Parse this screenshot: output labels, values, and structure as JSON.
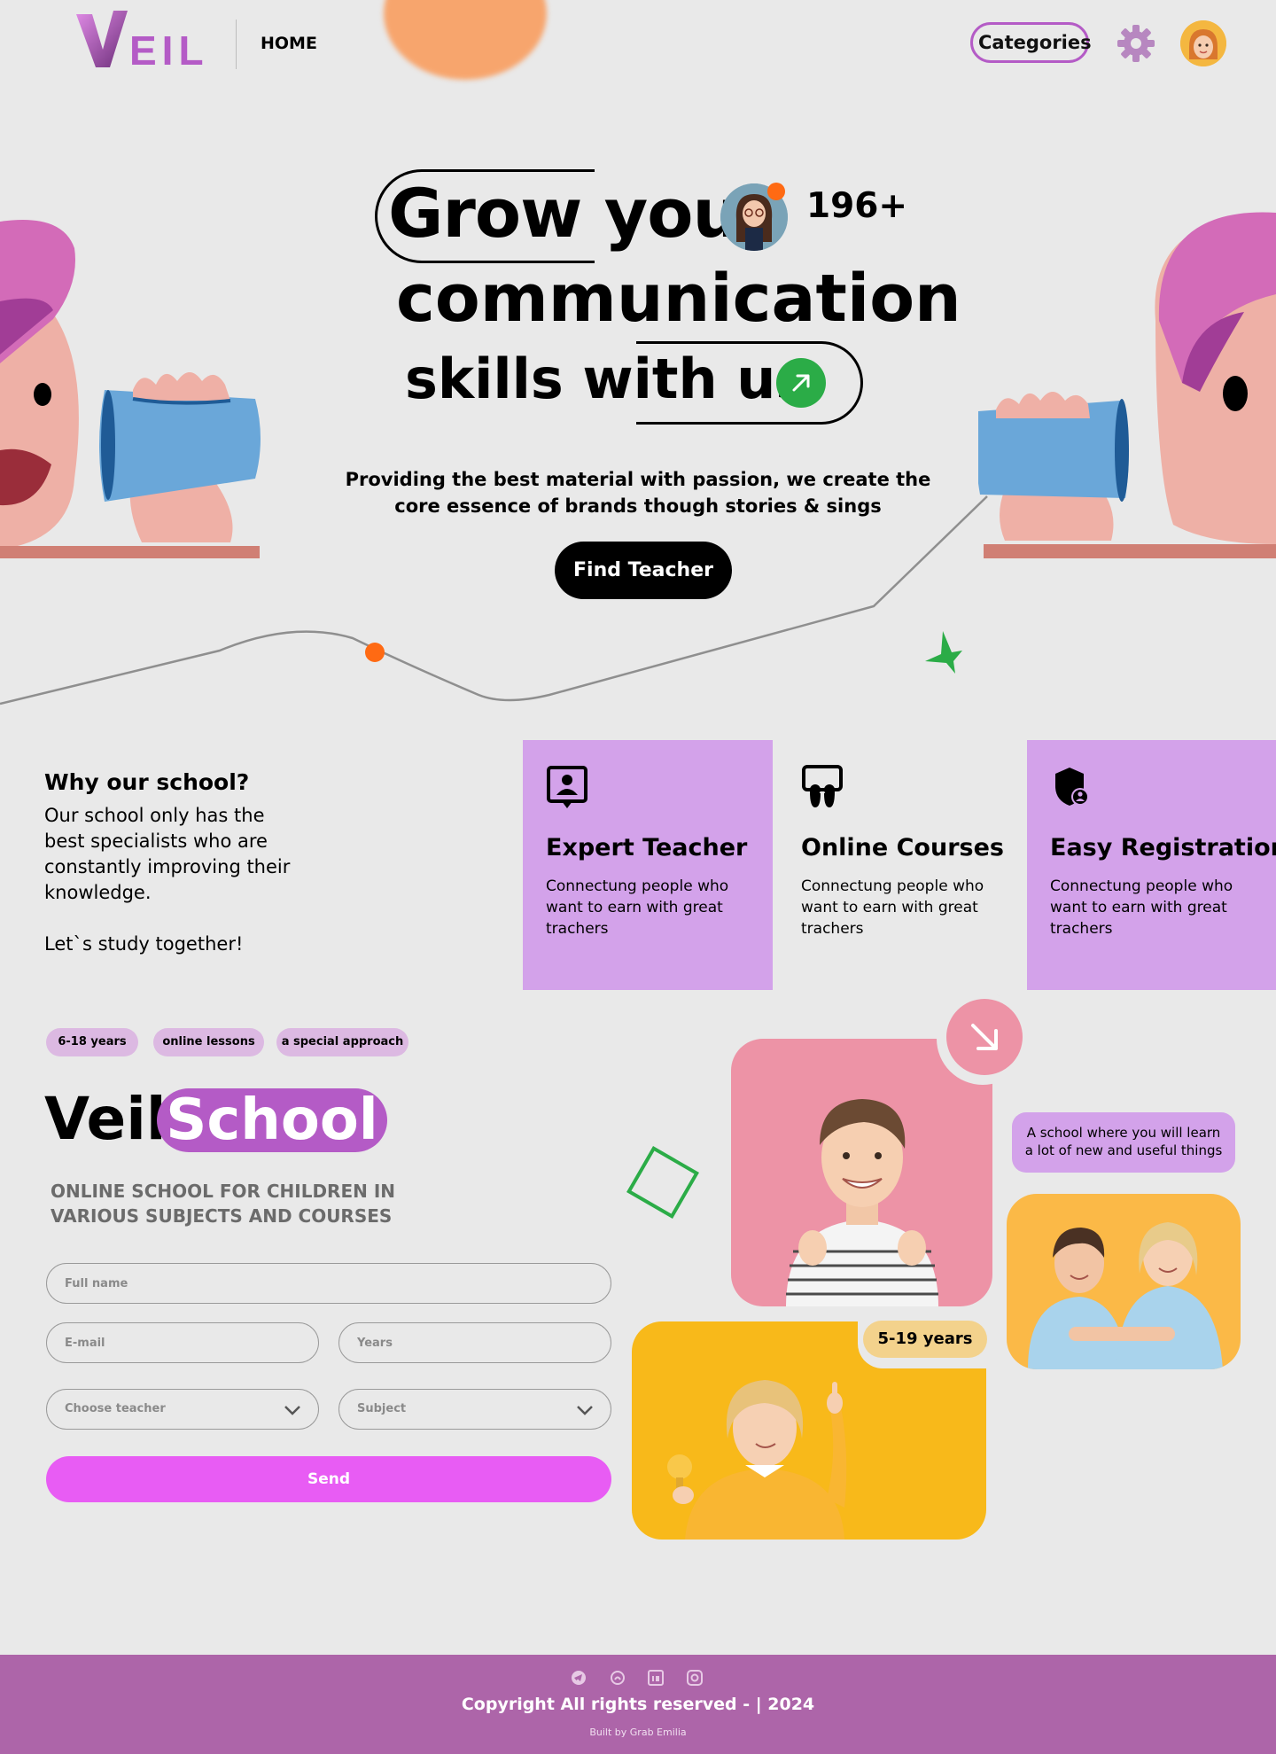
{
  "header": {
    "logo_text": "EIL",
    "nav_home": "HOME",
    "categories_label": "Categories"
  },
  "hero": {
    "line1": "Grow your",
    "line2": "communication",
    "line3": "skills with us",
    "count": "196+",
    "subtitle": "Providing the best material with passion, we create the core essence of brands though stories & sings",
    "find_label": "Find Teacher"
  },
  "why": {
    "title": "Why our school?",
    "text": "Our school only has the best specialists who are constantly improving their knowledge.",
    "cta": "Let`s study together!",
    "cards": [
      {
        "title": "Expert Teacher",
        "text": "Connectung people who want to earn with great trachers"
      },
      {
        "title": "Online Courses",
        "text": "Connectung people who want to earn with great trachers"
      },
      {
        "title": "Easy Registration",
        "text": "Connectung people who want to earn with great trachers"
      }
    ]
  },
  "school": {
    "tags": [
      "6-18 years",
      "online lessons",
      "a special approach"
    ],
    "title_word1": "Veil",
    "title_word2": "School",
    "subtitle": "ONLINE SCHOOL FOR CHILDREN IN VARIOUS SUBJECTS AND COURSES",
    "form": {
      "fullname_placeholder": "Full name",
      "email_placeholder": "E-mail",
      "years_placeholder": "Years",
      "teacher_select": "Choose teacher",
      "subject_select": "Subject",
      "send_label": "Send"
    },
    "age_badge": "5-19 years",
    "bubble": "A school where you will learn a lot of new and useful things"
  },
  "footer": {
    "copyright": "Copyright All rights reserved - | 2024",
    "built_by": "Built by Grab Emilia",
    "social_icons": [
      "telegram-icon",
      "github-icon",
      "linkedin-icon",
      "instagram-icon"
    ]
  },
  "colors": {
    "brand_purple": "#b45bc6",
    "card_purple": "#d3a2ea",
    "accent_green": "#2bac47",
    "accent_orange": "#ff6a13",
    "send_pink": "#e85cf4",
    "footer": "#ad65a9"
  }
}
